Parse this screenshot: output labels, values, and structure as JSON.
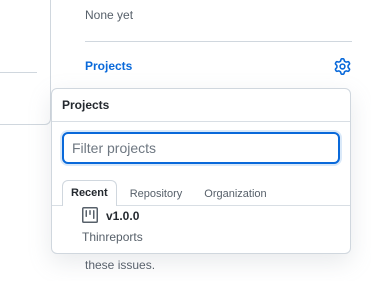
{
  "sidebar": {
    "linked_issues_value": "None yet",
    "projects_heading": "Projects",
    "gear_icon": "gear-icon",
    "behind_text": "these issues."
  },
  "popover": {
    "title": "Projects",
    "filter": {
      "placeholder": "Filter projects",
      "value": ""
    },
    "tabs": [
      {
        "label": "Recent",
        "selected": true
      },
      {
        "label": "Repository",
        "selected": false
      },
      {
        "label": "Organization",
        "selected": false
      }
    ],
    "results": [
      {
        "icon": "project-board-icon",
        "name": "v1.0.0",
        "repo": "Thinreports"
      }
    ]
  },
  "colors": {
    "accent": "#0969da",
    "border": "#d0d7de",
    "muted_text": "#57606a"
  }
}
